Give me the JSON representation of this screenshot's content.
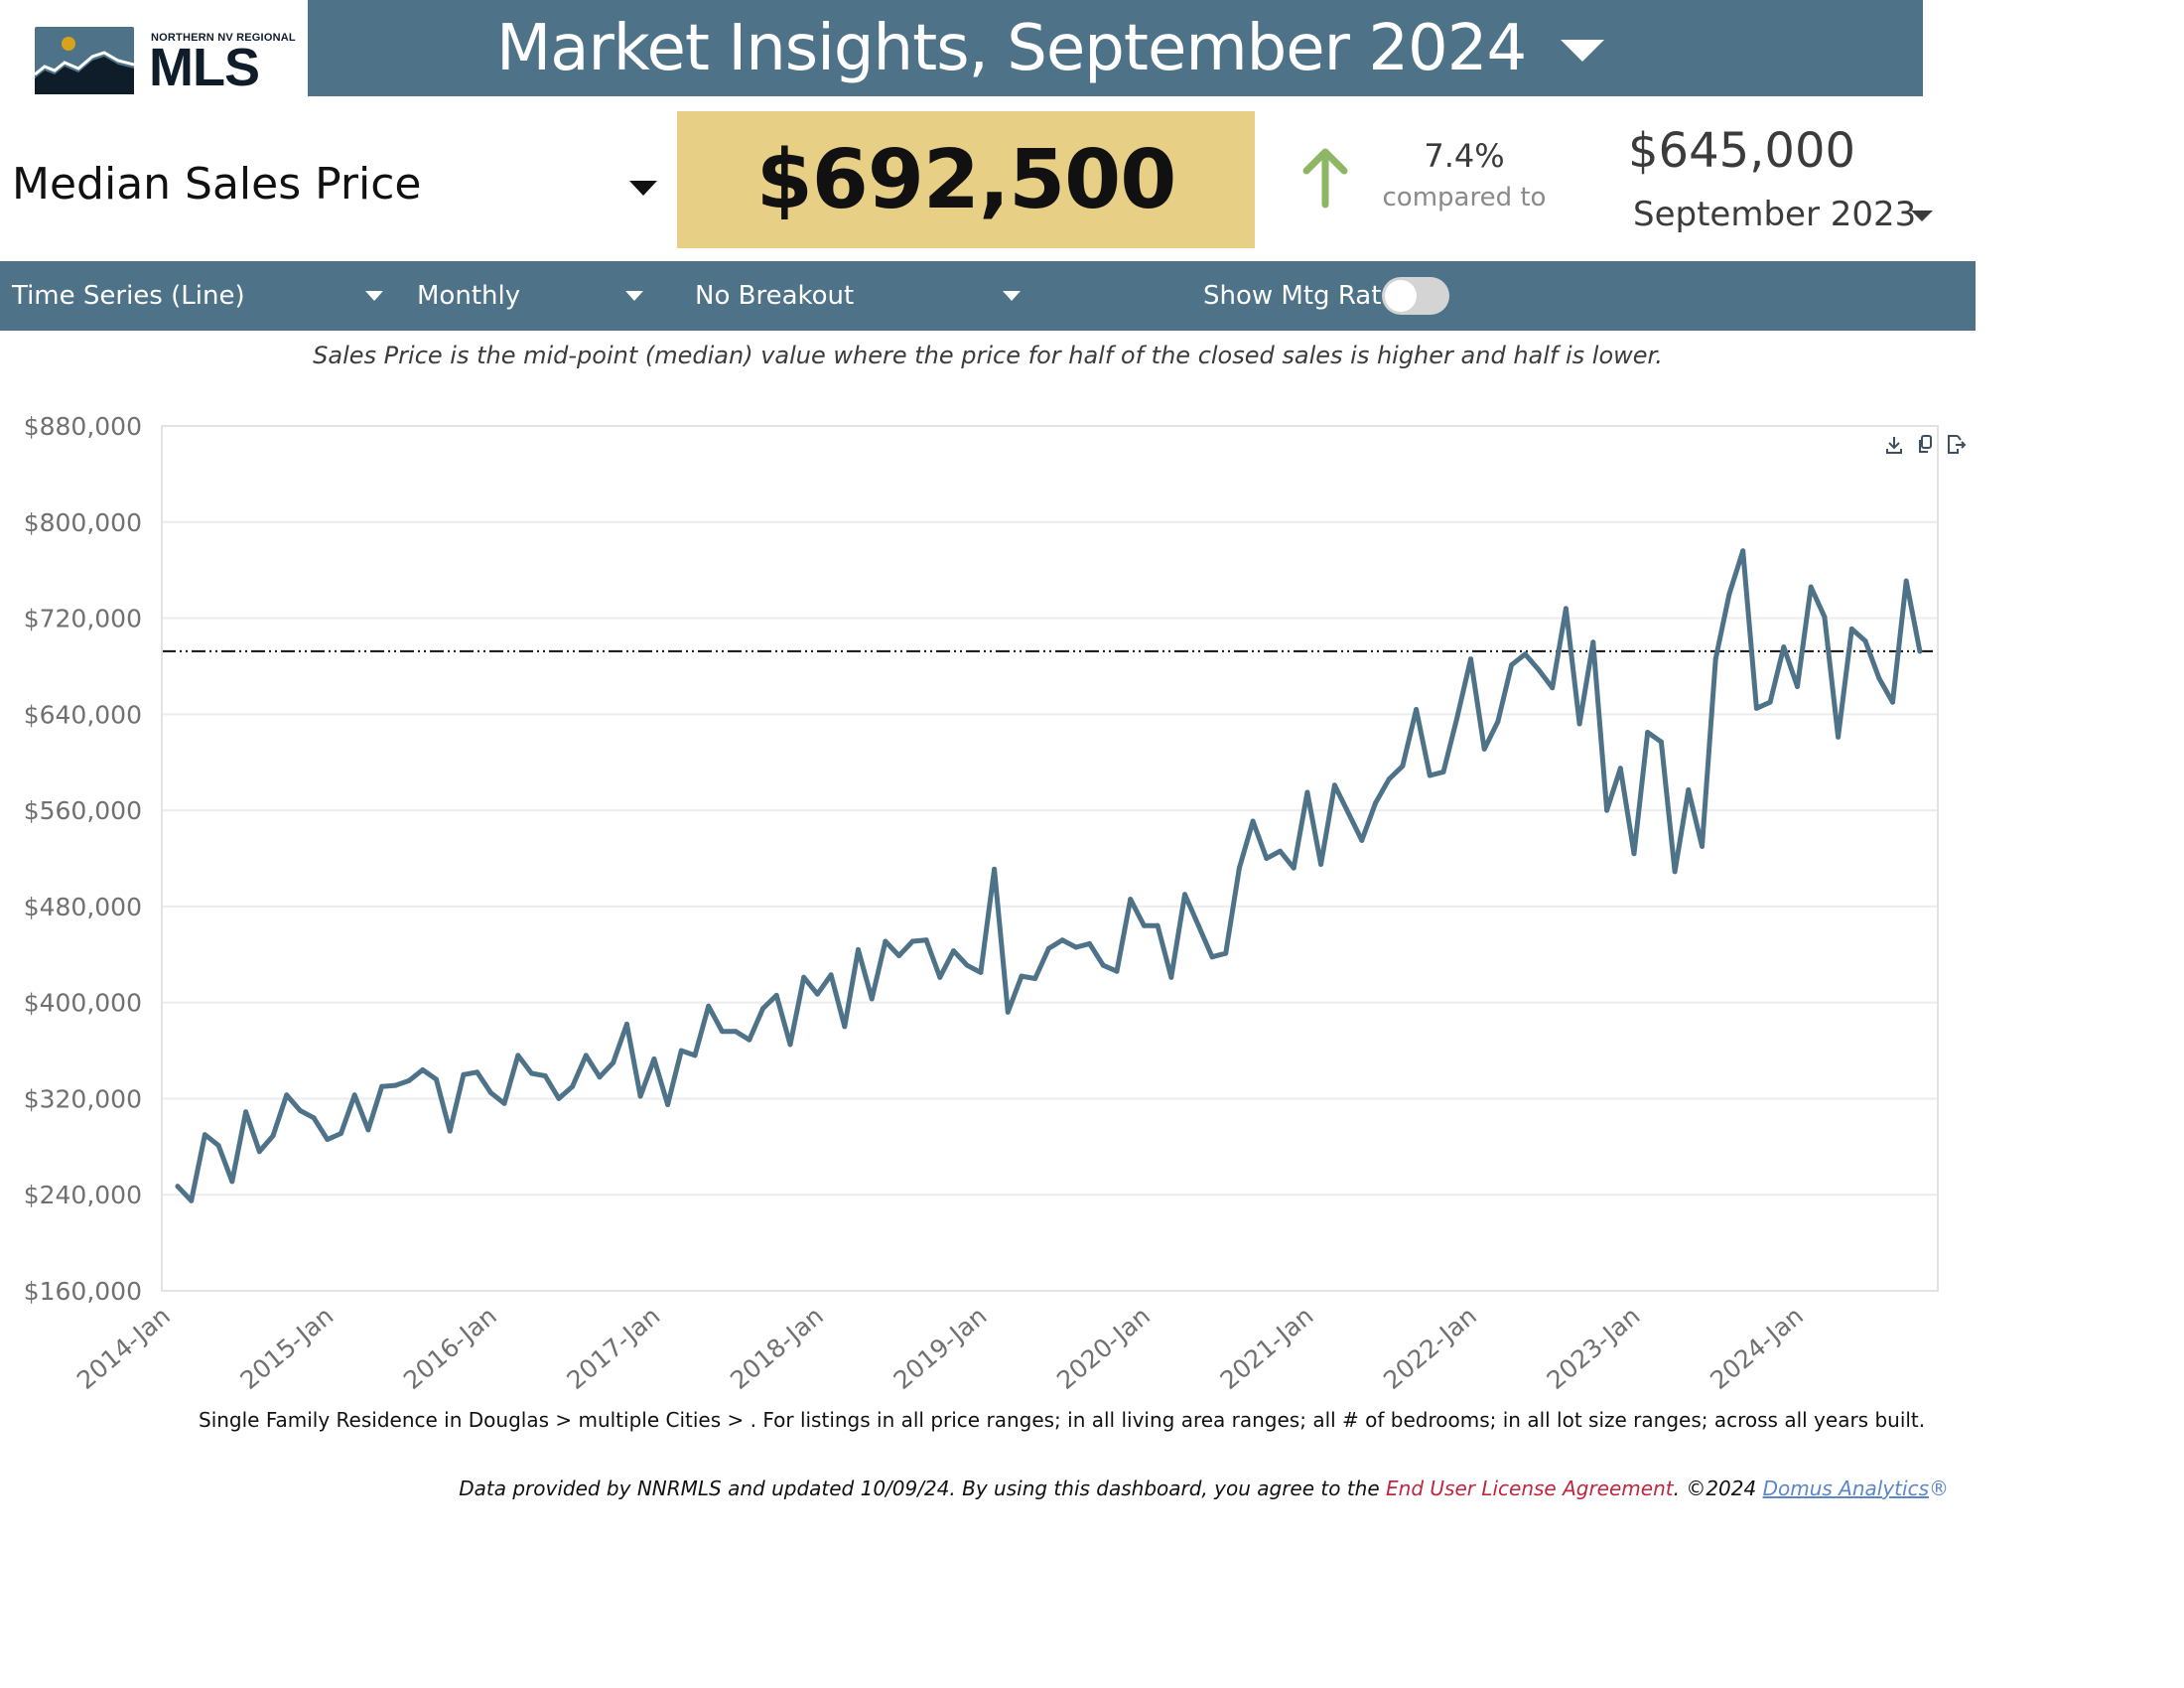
{
  "logo": {
    "small_text": "NORTHERN NV REGIONAL",
    "big_text": "MLS",
    "colors": {
      "sky": "#4e7389",
      "sun": "#d9a21b",
      "mountain": "#0f1c2a"
    }
  },
  "header": {
    "title": "Market Insights, September 2024",
    "dropdown_icon": "caret-down-icon",
    "background": "#4e7389"
  },
  "metric": {
    "label": "Median Sales Price",
    "value": "$692,500",
    "change_icon": "arrow-up-icon",
    "change_color": "#8db665",
    "change_pct": "7.4%",
    "compared_label": "compared to",
    "prior_value": "$645,000",
    "prior_period": "September 2023",
    "box_color": "#e8cf86"
  },
  "controls": {
    "chart_type": "Time Series (Line)",
    "interval": "Monthly",
    "breakout": "No Breakout",
    "mtg_rate_label": "Show Mtg Rate:",
    "mtg_rate_on": false
  },
  "description": "Sales Price is the mid-point (median) value where the price for half of the closed sales is higher and half is lower.",
  "chart_toolbar": [
    "download-icon",
    "copy-icon",
    "export-icon"
  ],
  "footer": {
    "filter_text": "Single Family Residence in Douglas > multiple Cities > . For listings in all price ranges; in all living area ranges; all # of bedrooms; in all lot size ranges; across all years built.",
    "data_text": "Data provided by NNRMLS and updated 10/09/24.  By using this dashboard, you agree to the ",
    "eula_link": "End User License Agreement",
    "copyright": ".  ©2024 ",
    "domus_link": "Domus Analytics",
    "registered": "®"
  },
  "chart_data": {
    "type": "line",
    "title": "",
    "xlabel": "",
    "ylabel": "",
    "line_color": "#4e7389",
    "reference_line": {
      "value": 692500,
      "style": "dash-dot",
      "color": "#111111"
    },
    "ylim": [
      160000,
      880000
    ],
    "yticks": [
      160000,
      240000,
      320000,
      400000,
      480000,
      560000,
      640000,
      720000,
      800000,
      880000
    ],
    "ytick_labels": [
      "$160,000",
      "$240,000",
      "$320,000",
      "$400,000",
      "$480,000",
      "$560,000",
      "$640,000",
      "$720,000",
      "$800,000",
      "$880,000"
    ],
    "xtick_labels": [
      "2014-Jan",
      "2015-Jan",
      "2016-Jan",
      "2017-Jan",
      "2018-Jan",
      "2019-Jan",
      "2020-Jan",
      "2021-Jan",
      "2022-Jan",
      "2023-Jan",
      "2024-Jan"
    ],
    "x_start": "2014-Jan",
    "x_end": "2024-Sep",
    "grid": true,
    "legend": "none",
    "series": [
      {
        "name": "Median Sales Price",
        "values": [
          247000,
          235000,
          290000,
          281000,
          251000,
          309000,
          276000,
          289000,
          323000,
          310000,
          304000,
          286000,
          291000,
          323000,
          294000,
          330000,
          331000,
          335000,
          344000,
          336000,
          293000,
          340000,
          342000,
          325000,
          316000,
          356000,
          341000,
          339000,
          320000,
          330000,
          356000,
          338000,
          350000,
          382000,
          322000,
          353000,
          315000,
          360000,
          356000,
          397000,
          376000,
          376000,
          369000,
          395000,
          406000,
          365000,
          421000,
          407000,
          423000,
          380000,
          444000,
          403000,
          451000,
          439000,
          451000,
          452000,
          421000,
          443000,
          431000,
          425000,
          511000,
          392000,
          422000,
          420000,
          445000,
          452000,
          446000,
          449000,
          431000,
          426000,
          486000,
          464000,
          464000,
          421000,
          490000,
          464000,
          438000,
          441000,
          512000,
          551000,
          520000,
          526000,
          512000,
          575000,
          515000,
          581000,
          558000,
          535000,
          566000,
          586000,
          597000,
          644000,
          589000,
          592000,
          637000,
          686000,
          611000,
          634000,
          681000,
          690000,
          677000,
          662000,
          728000,
          632000,
          700000,
          560000,
          595000,
          524000,
          625000,
          617000,
          509000,
          577000,
          530000,
          686000,
          740000,
          776000,
          645000,
          650000,
          696000,
          663000,
          746000,
          721000,
          621000,
          711000,
          701000,
          670000,
          650000,
          751000,
          692500
        ]
      }
    ]
  }
}
